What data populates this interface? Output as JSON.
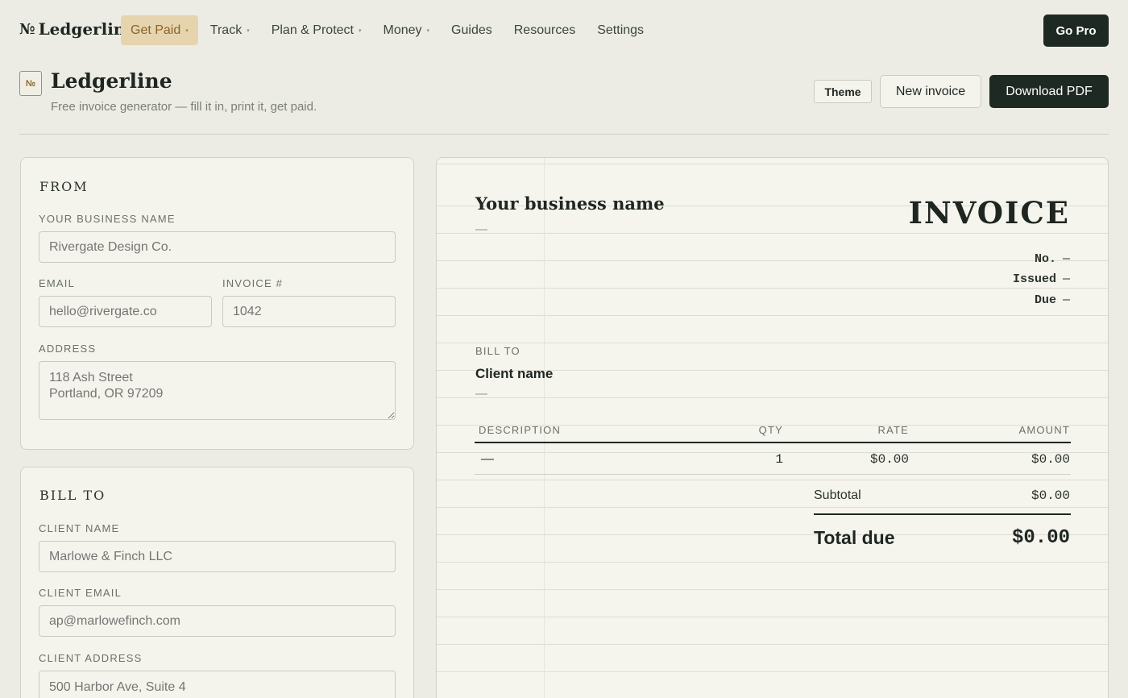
{
  "nav": {
    "brand_mark": "№",
    "brand": "Ledgerline",
    "items": [
      {
        "label": "Get Paid",
        "caret": "▾"
      },
      {
        "label": "Track",
        "caret": "▾"
      },
      {
        "label": "Plan & Protect",
        "caret": "▾"
      },
      {
        "label": "Money",
        "caret": "▾"
      },
      {
        "label": "Guides"
      },
      {
        "label": "Resources"
      },
      {
        "label": "Settings"
      }
    ],
    "cta": "Go Pro"
  },
  "header": {
    "icon_glyph": "№",
    "title": "Ledgerline",
    "subtitle": "Free invoice generator — fill it in, print it, get paid.",
    "theme_button": "Theme",
    "new_button": "New invoice",
    "pdf_button": "Download PDF"
  },
  "from": {
    "heading": "FROM",
    "business_label": "YOUR BUSINESS NAME",
    "business_placeholder": "Rivergate Design Co.",
    "email_label": "EMAIL",
    "email_placeholder": "hello@rivergate.co",
    "invoice_label": "INVOICE #",
    "invoice_placeholder": "1042",
    "address_label": "ADDRESS",
    "address_placeholder": "118 Ash Street\nPortland, OR 97209"
  },
  "bill_to": {
    "heading": "BILL TO",
    "name_label": "CLIENT NAME",
    "name_placeholder": "Marlowe & Finch LLC",
    "email_label": "CLIENT EMAIL",
    "email_placeholder": "ap@marlowefinch.com",
    "address_label": "CLIENT ADDRESS",
    "address_placeholder": "500 Harbor Ave, Suite 4"
  },
  "invoice": {
    "business_name": "Your business name",
    "business_sub": "—",
    "title": "INVOICE",
    "meta": [
      {
        "label": "No.",
        "value": "—"
      },
      {
        "label": "Issued",
        "value": "—"
      },
      {
        "label": "Due",
        "value": "—"
      }
    ],
    "bill_to_label": "BILL TO",
    "client_name": "Client name",
    "client_sub": "—",
    "columns": {
      "description": "DESCRIPTION",
      "qty": "QTY",
      "rate": "RATE",
      "amount": "AMOUNT"
    },
    "items": [
      {
        "description": "—",
        "qty": "1",
        "rate": "$0.00",
        "amount": "$0.00"
      }
    ],
    "subtotal_label": "Subtotal",
    "subtotal_value": "$0.00",
    "total_label": "Total due",
    "total_value": "$0.00"
  }
}
